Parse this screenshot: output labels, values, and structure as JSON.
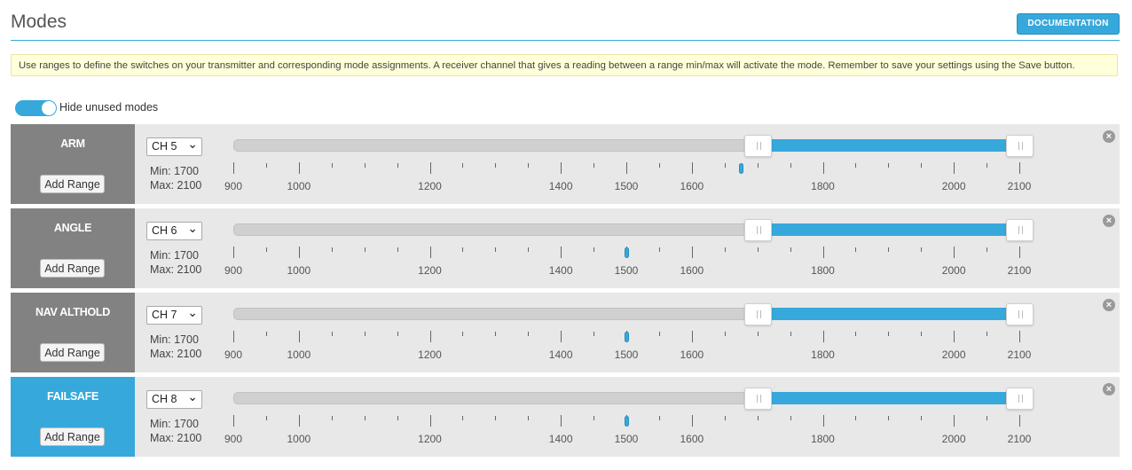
{
  "header": {
    "title": "Modes",
    "documentation_label": "DOCUMENTATION"
  },
  "note": "Use ranges to define the switches on your transmitter and corresponding mode assignments. A receiver channel that gives a reading between a range min/max will activate the mode. Remember to save your settings using the Save button.",
  "toggle": {
    "label": "Hide unused modes",
    "checked": true
  },
  "scale": {
    "min": 900,
    "max": 2100,
    "labels": [
      900,
      1000,
      1200,
      1400,
      1500,
      1600,
      1800,
      2000,
      2100
    ]
  },
  "add_range_label": "Add Range",
  "colors": {
    "accent": "#37a8db",
    "mode_inactive": "#828282",
    "mode_active": "#37a8db"
  },
  "modes": [
    {
      "name": "ARM",
      "channel": "CH 5",
      "min_label": "Min: 1700",
      "max_label": "Max: 2100",
      "range_min": 1700,
      "range_max": 2100,
      "current_value": 1675,
      "active": false
    },
    {
      "name": "ANGLE",
      "channel": "CH 6",
      "min_label": "Min: 1700",
      "max_label": "Max: 2100",
      "range_min": 1700,
      "range_max": 2100,
      "current_value": 1500,
      "active": false
    },
    {
      "name": "NAV ALTHOLD",
      "channel": "CH 7",
      "min_label": "Min: 1700",
      "max_label": "Max: 2100",
      "range_min": 1700,
      "range_max": 2100,
      "current_value": 1500,
      "active": false
    },
    {
      "name": "FAILSAFE",
      "channel": "CH 8",
      "min_label": "Min: 1700",
      "max_label": "Max: 2100",
      "range_min": 1700,
      "range_max": 2100,
      "current_value": 1500,
      "active": true
    }
  ]
}
